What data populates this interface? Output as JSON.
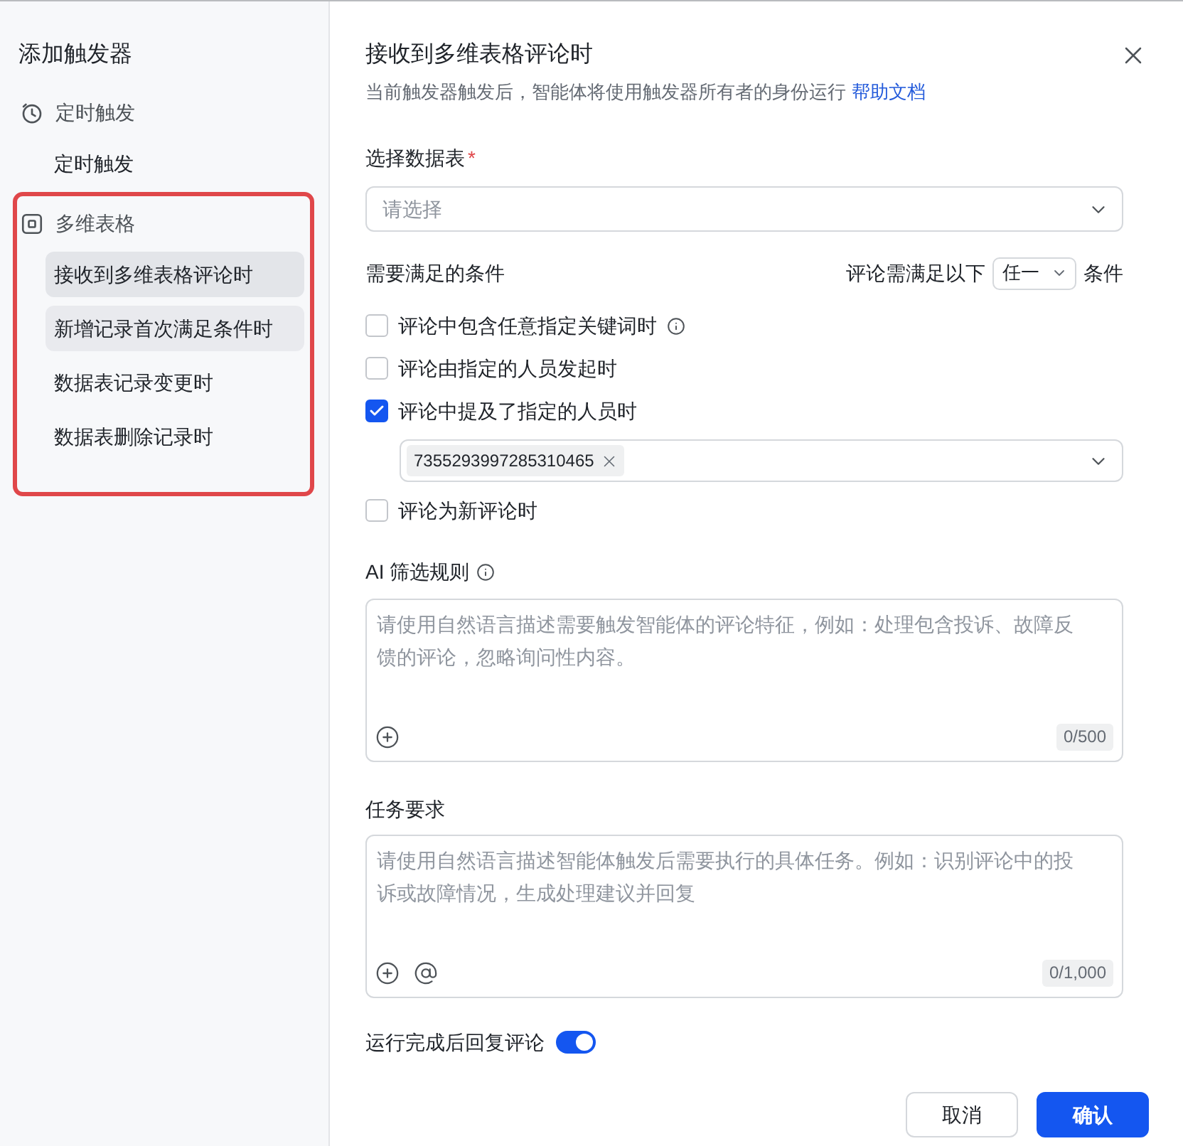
{
  "sidebar": {
    "title": "添加触发器",
    "groups": [
      {
        "label": "定时触发",
        "kind": "timer",
        "outlined": false,
        "items": [
          {
            "label": "定时触发",
            "selected": false,
            "hovered": false
          }
        ]
      },
      {
        "label": "多维表格",
        "kind": "table",
        "outlined": true,
        "items": [
          {
            "label": "接收到多维表格评论时",
            "selected": true,
            "hovered": false
          },
          {
            "label": "新增记录首次满足条件时",
            "selected": false,
            "hovered": true
          },
          {
            "label": "数据表记录变更时",
            "selected": false,
            "hovered": false
          },
          {
            "label": "数据表删除记录时",
            "selected": false,
            "hovered": false
          }
        ]
      }
    ]
  },
  "dialog": {
    "title": "接收到多维表格评论时",
    "subtitle": "当前触发器触发后，智能体将使用触发器所有者的身份运行",
    "help_link": "帮助文档"
  },
  "table_field": {
    "label": "选择数据表",
    "required_mark": "*",
    "placeholder": "请选择"
  },
  "conditions": {
    "label": "需要满足的条件",
    "match_prefix": "评论需满足以下",
    "match_value": "任一",
    "match_suffix": "条件",
    "options": [
      {
        "label": "评论中包含任意指定关键词时",
        "checked": false,
        "info": true
      },
      {
        "label": "评论由指定的人员发起时",
        "checked": false,
        "info": false
      },
      {
        "label": "评论中提及了指定的人员时",
        "checked": true,
        "info": false,
        "people": [
          "7355293997285310465"
        ]
      },
      {
        "label": "评论为新评论时",
        "checked": false,
        "info": false
      }
    ]
  },
  "prompts": [
    {
      "label": "AI 筛选规则",
      "info": true,
      "placeholder": "请使用自然语言描述需要触发智能体的评论特征，例如：处理包含投诉、故障反馈的评论，忽略询问性内容。",
      "counter": "0/500",
      "tools": [
        {
          "kind": "add"
        }
      ]
    },
    {
      "label": "任务要求",
      "info": false,
      "placeholder": "请使用自然语言描述智能体触发后需要执行的具体任务。例如：识别评论中的投诉或故障情况，生成处理建议并回复",
      "counter": "0/1,000",
      "tools": [
        {
          "kind": "add"
        },
        {
          "kind": "mention"
        }
      ]
    }
  ],
  "reply_toggle": {
    "label": "运行完成后回复评论",
    "on": true
  },
  "buttons": [
    {
      "label": "取消",
      "kind": "secondary"
    },
    {
      "label": "确认",
      "kind": "primary"
    }
  ]
}
